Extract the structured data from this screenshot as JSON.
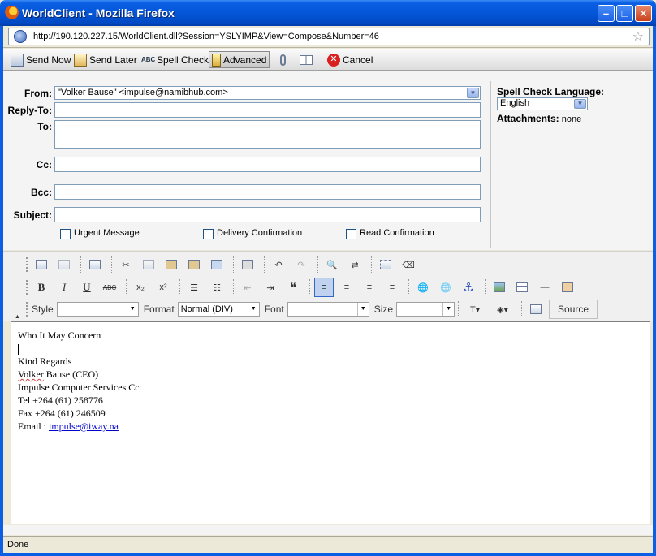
{
  "window": {
    "title": "WorldClient - Mozilla Firefox",
    "min_glyph": "–",
    "max_glyph": "□",
    "close_glyph": "✕"
  },
  "urlbar": {
    "url": "http://190.120.227.15/WorldClient.dll?Session=YSLYIMP&View=Compose&Number=46",
    "star_glyph": "☆"
  },
  "compose_toolbar": {
    "send_now": "Send Now",
    "send_later": "Send Later",
    "spell_check": "Spell Check",
    "spell_icon_text": "ABC",
    "advanced": "Advanced",
    "cancel": "Cancel",
    "cancel_icon_text": "✕"
  },
  "headers": {
    "from_label": "From:",
    "from_value": "\"Volker Bause\" <impulse@namibhub.com>",
    "reply_to_label": "Reply-To:",
    "to_label": "To:",
    "cc_label": "Cc:",
    "bcc_label": "Bcc:",
    "subject_label": "Subject:",
    "urgent": "Urgent Message",
    "delivery": "Delivery Confirmation",
    "read": "Read Confirmation",
    "dropdown_glyph": "▼"
  },
  "side": {
    "spell_lang_label": "Spell Check Language:",
    "spell_lang_value": "English",
    "attachments_label": "Attachments:",
    "attachments_value": "none"
  },
  "editor_toolbar": {
    "style_label": "Style",
    "style_value": "",
    "format_label": "Format",
    "format_value": "Normal (DIV)",
    "font_label": "Font",
    "font_value": "",
    "size_label": "Size",
    "size_value": "",
    "source": "Source",
    "bold": "B",
    "italic": "I",
    "underline": "U",
    "strike": "ABC",
    "subscript": "x₂",
    "superscript": "x²",
    "quote": "❝",
    "anchor": "⚓",
    "collapse_glyph": "▲",
    "combo_arrow": "▼"
  },
  "editor": {
    "line1": "Who It May Concern",
    "line3": "Kind Regards",
    "name_first": "Volker",
    "name_rest": " Bause (CEO)",
    "line5": "Impulse Computer Services Cc",
    "line6": "Tel +264 (61) 258776",
    "line7": "Fax +264 (61) 246509",
    "email_label": "Email : ",
    "email_link": "impulse@iway.na"
  },
  "status": {
    "text": "Done"
  }
}
